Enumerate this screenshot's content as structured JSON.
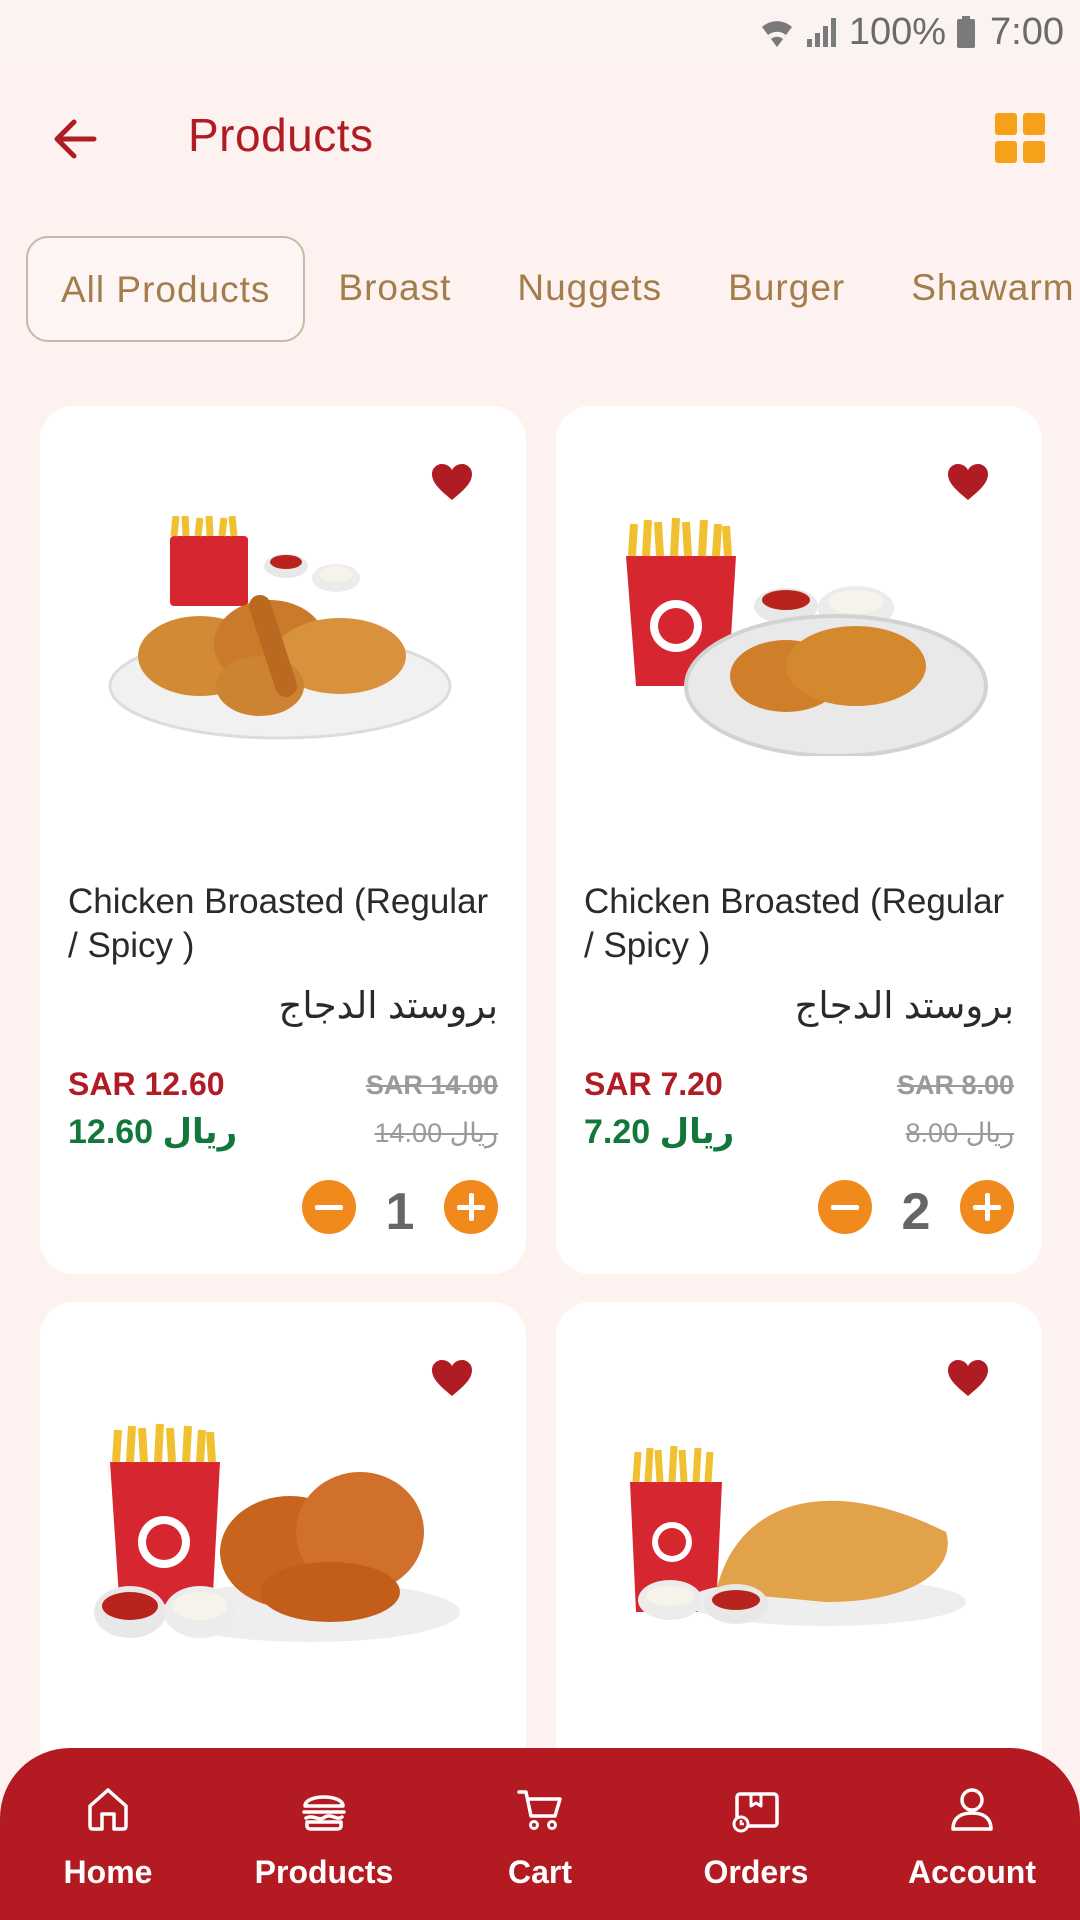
{
  "status_bar": {
    "battery": "100%",
    "time": "7:00"
  },
  "header": {
    "title": "Products"
  },
  "tabs": [
    {
      "label": "All Products",
      "active": true
    },
    {
      "label": "Broast"
    },
    {
      "label": "Nuggets"
    },
    {
      "label": "Burger"
    },
    {
      "label": "Shawarm"
    }
  ],
  "products": [
    {
      "name": "Chicken Broasted (Regular / Spicy )",
      "name_ar": "بروستد الدجاج",
      "price": "SAR 12.60",
      "old_price": "SAR 14.00",
      "price_ar": "12.60 ريال",
      "old_price_ar": "14.00 ريال",
      "quantity": "1"
    },
    {
      "name": "Chicken Broasted (Regular / Spicy )",
      "name_ar": "بروستد الدجاج",
      "price": "SAR 7.20",
      "old_price": "SAR 8.00",
      "price_ar": "7.20 ريال",
      "old_price_ar": "8.00 ريال",
      "quantity": "2"
    },
    {
      "name": "",
      "favorite": true
    },
    {
      "name": "",
      "favorite": true
    }
  ],
  "nav": [
    {
      "label": "Home",
      "icon": "home-icon"
    },
    {
      "label": "Products",
      "icon": "burger-icon"
    },
    {
      "label": "Cart",
      "icon": "cart-icon"
    },
    {
      "label": "Orders",
      "icon": "orders-icon"
    },
    {
      "label": "Account",
      "icon": "account-icon"
    }
  ],
  "colors": {
    "brand_red": "#b31a21",
    "accent_orange": "#f08a1c",
    "arabic_price_green": "#12773b",
    "tab_text": "#a37e4c",
    "background": "#fdf2f0"
  }
}
